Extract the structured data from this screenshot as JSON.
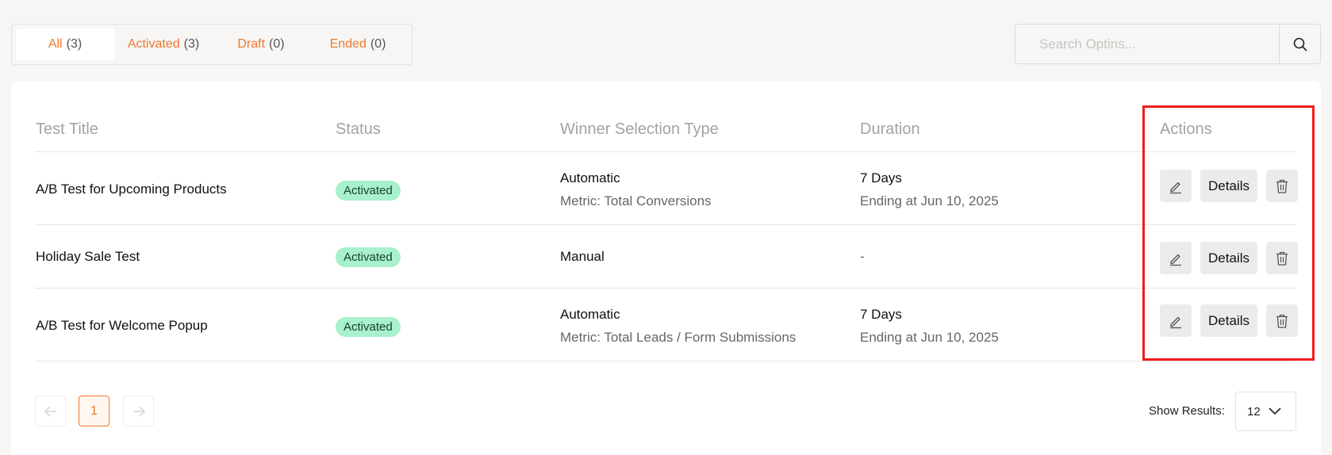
{
  "tabs": [
    {
      "label": "All",
      "count": "(3)"
    },
    {
      "label": "Activated",
      "count": "(3)"
    },
    {
      "label": "Draft",
      "count": "(0)"
    },
    {
      "label": "Ended",
      "count": "(0)"
    }
  ],
  "search": {
    "placeholder": "Search Optins...",
    "icon": "search-icon"
  },
  "table": {
    "headers": {
      "title": "Test Title",
      "status": "Status",
      "winner": "Winner Selection Type",
      "duration": "Duration",
      "actions": "Actions"
    },
    "rows": [
      {
        "title": "A/B Test for Upcoming Products",
        "status": "Activated",
        "winner": "Automatic",
        "metric": "Metric: Total Conversions",
        "duration": "7 Days",
        "ending": "Ending at Jun 10, 2025",
        "details": "Details"
      },
      {
        "title": "Holiday Sale Test",
        "status": "Activated",
        "winner": "Manual",
        "metric": "",
        "duration": "-",
        "ending": "",
        "details": "Details"
      },
      {
        "title": "A/B Test for Welcome Popup",
        "status": "Activated",
        "winner": "Automatic",
        "metric": "Metric: Total Leads / Form Submissions",
        "duration": "7 Days",
        "ending": "Ending at Jun 10, 2025",
        "details": "Details"
      }
    ]
  },
  "pagination": {
    "current_page": "1"
  },
  "results": {
    "label": "Show Results:",
    "value": "12"
  },
  "colors": {
    "accent": "#f0782b",
    "badge_bg": "#a9f0cc",
    "highlight": "#f21c1c"
  }
}
